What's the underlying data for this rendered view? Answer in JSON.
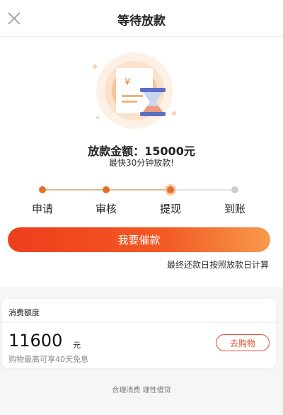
{
  "header": {
    "title": "等待放款",
    "close_icon": "close-icon"
  },
  "illustration": {
    "currency_symbol": "¥"
  },
  "loan": {
    "amount_line": "放款金额：15000元",
    "subtitle": "最快30分钟放款!"
  },
  "steps": [
    {
      "label": "申请",
      "state": "done"
    },
    {
      "label": "审核",
      "state": "done"
    },
    {
      "label": "提现",
      "state": "current"
    },
    {
      "label": "到账",
      "state": "pending"
    }
  ],
  "actions": {
    "urge_label": "我要催款",
    "note": "最终还款日按照放款日计算"
  },
  "card": {
    "title": "消费额度",
    "credit_amount": "11600",
    "credit_unit": "元",
    "credit_desc": "购物最高可享40天免息",
    "shop_label": "去购物"
  },
  "footer": {
    "slogan": "合理消费 理性借贷"
  },
  "colors": {
    "accent": "#e5702b",
    "button_start": "#ee3d1c",
    "button_end": "#f79a4c",
    "shop_border": "#e04b2e"
  }
}
